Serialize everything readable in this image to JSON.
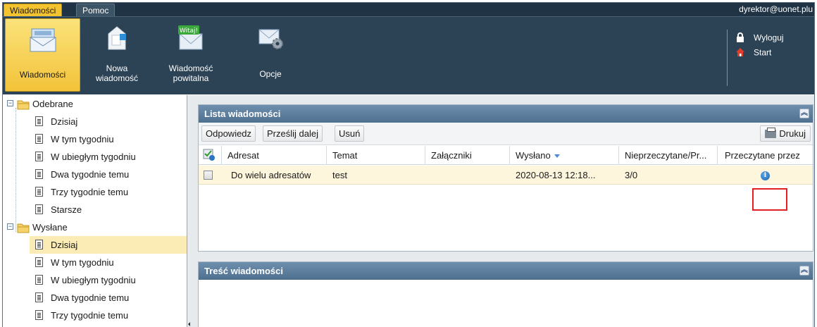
{
  "menu": {
    "tabs": [
      {
        "label": "Wiadomości",
        "active": true
      },
      {
        "label": "Pomoc",
        "active": false
      }
    ],
    "user_email": "dyrektor@uonet.plu"
  },
  "toolbar": {
    "buttons": [
      {
        "label": "Wiadomości",
        "icon": "inbox-envelope-icon",
        "active": true
      },
      {
        "label": "Nowa wiadomość",
        "icon": "new-message-icon",
        "active": false
      },
      {
        "label": "Wiadomość powitalna",
        "icon": "welcome-message-icon",
        "badge": "Witaj!",
        "active": false
      },
      {
        "label": "Opcje",
        "icon": "options-envelope-gear-icon",
        "active": false
      }
    ],
    "logout_label": "Wyloguj",
    "start_label": "Start"
  },
  "tree": {
    "received": {
      "label": "Odebrane",
      "items": [
        "Dzisiaj",
        "W tym tygodniu",
        "W ubiegłym tygodniu",
        "Dwa tygodnie temu",
        "Trzy tygodnie temu",
        "Starsze"
      ]
    },
    "sent": {
      "label": "Wysłane",
      "selected_index": 0,
      "items": [
        "Dzisiaj",
        "W tym tygodniu",
        "W ubiegłym tygodniu",
        "Dwa tygodnie temu",
        "Trzy tygodnie temu"
      ]
    }
  },
  "message_list": {
    "title": "Lista wiadomości",
    "actions": [
      "Odpowiedz",
      "Prześlij dalej",
      "Usuń"
    ],
    "print_label": "Drukuj",
    "columns": [
      "Adresat",
      "Temat",
      "Załączniki",
      "Wysłano",
      "Nieprzeczytane/Pr...",
      "Przeczytane przez"
    ],
    "sorted_column": "Wysłano",
    "rows": [
      {
        "adresat": "Do wielu adresatów",
        "temat": "test",
        "zalaczniki": "",
        "wyslano": "2020-08-13 12:18...",
        "nieprzeczytane": "3/0",
        "przeczytane_przez": "info-icon"
      }
    ]
  },
  "message_body": {
    "title": "Treść wiadomości"
  },
  "colors": {
    "menubar": "#1f3344",
    "toolbar": "#2c4356",
    "active_yellow": "#f4c430",
    "panel_header": "#5f80a0",
    "selected_row": "#fdf5dc",
    "highlight_box": "#e02020"
  }
}
